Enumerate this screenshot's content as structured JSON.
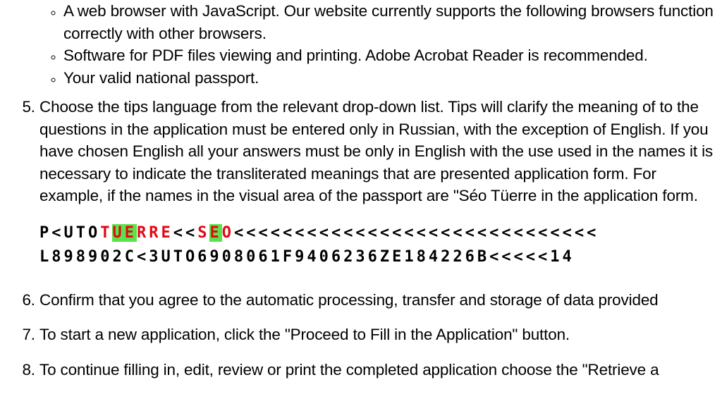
{
  "bullets": {
    "b1": "A web browser with JavaScript. Our website currently supports the following browsers function correctly with other browsers.",
    "b2": "Software for PDF files viewing and printing. Adobe Acrobat Reader is recommended.",
    "b3": "Your valid national passport."
  },
  "items": {
    "n5": "Choose the tips language from the relevant drop-down list. Tips will clarify the meaning of to the questions in the application must be entered only in Russian, with the exception of English. If you have chosen English all your answers must be only in English with the use used in the names it is necessary to indicate the transliterated meanings that are presented application form. For example, if the names in the visual area of the passport are \"Séo Tüerre in the application form.",
    "n6": "Confirm that you agree to the automatic processing, transfer and storage of data provided",
    "n7": "To start a new application, click the \"Proceed to Fill in the Application\" button.",
    "n8": "To continue filling in, edit, review or print the completed application choose the \"Retrieve a"
  },
  "mrz": {
    "l1a": "P<UTO",
    "l1b_plain_before_hl1": "T",
    "l1b_hl1": "UE",
    "l1b_after_hl1": "RRE",
    "l1c_sep": "<<",
    "l1d_before_hl2": "S",
    "l1d_hl2": "E",
    "l1d_after_hl2": "O",
    "l1e_tail": "<<<<<<<<<<<<<<<<<<<<<<<<<<<<<<",
    "l2": "L898902C<3UTO6908061F9406236ZE184226B<<<<<14"
  }
}
